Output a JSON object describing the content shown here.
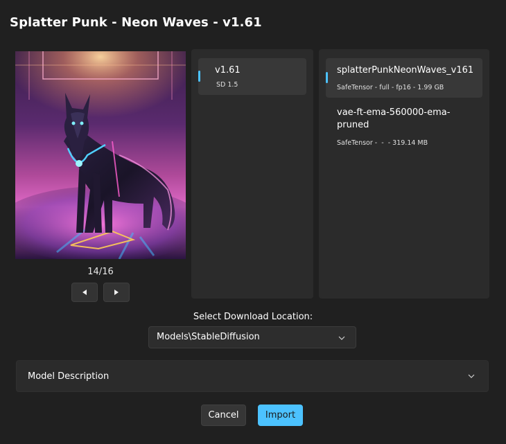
{
  "dialog": {
    "title": "Splatter Punk - Neon Waves - v1.61"
  },
  "preview": {
    "image_desc_icon": "wolf-preview-image",
    "page_counter": "14/16"
  },
  "versions": [
    {
      "name": "v1.61",
      "base_model": "SD 1.5",
      "selected": true
    }
  ],
  "files": [
    {
      "name": "splatterPunkNeonWaves_v161",
      "meta": "SafeTensor - full - fp16 - 1.99 GB",
      "selected": true
    },
    {
      "name": "vae-ft-ema-560000-ema-pruned",
      "meta": "SafeTensor -  -  - 319.14 MB",
      "selected": false
    }
  ],
  "download": {
    "label": "Select Download Location:",
    "selected": "Models\\StableDiffusion"
  },
  "description": {
    "title": "Model Description"
  },
  "buttons": {
    "cancel": "Cancel",
    "import": "Import"
  },
  "colors": {
    "background": "#202020",
    "panel": "#2b2b2b",
    "selected_item": "#383838",
    "accent": "#4cc2ff"
  }
}
